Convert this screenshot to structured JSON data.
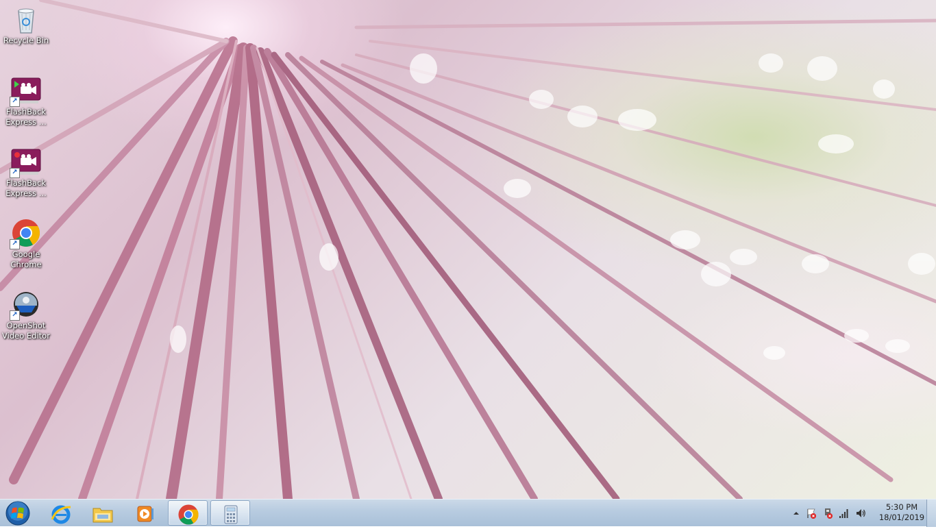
{
  "desktop": {
    "icons": [
      {
        "label_1": "Recycle Bin",
        "label_2": "",
        "icon": "recycle-bin-icon"
      },
      {
        "label_1": "FlashBack",
        "label_2": "Express ...",
        "icon": "flashback-player-icon"
      },
      {
        "label_1": "FlashBack",
        "label_2": "Express ...",
        "icon": "flashback-recorder-icon"
      },
      {
        "label_1": "Google",
        "label_2": "Chrome",
        "icon": "chrome-icon"
      },
      {
        "label_1": "OpenShot",
        "label_2": "Video Editor",
        "icon": "openshot-icon"
      }
    ]
  },
  "taskbar": {
    "pinned": [
      {
        "icon": "internet-explorer-icon"
      },
      {
        "icon": "windows-explorer-icon"
      },
      {
        "icon": "media-player-icon"
      },
      {
        "icon": "chrome-icon"
      },
      {
        "icon": "calculator-icon"
      }
    ],
    "tray": {
      "icons": [
        "show-hidden-icons-arrow",
        "action-center-flag-icon",
        "safely-remove-hardware-icon",
        "network-signal-icon",
        "volume-icon"
      ],
      "time": "5:30 PM",
      "date": "18/01/2019"
    }
  },
  "colors": {
    "taskbar": "#b7cbe0",
    "flashback": "#8a1c5c",
    "chrome_red": "#db4437",
    "chrome_green": "#0f9d58",
    "chrome_yellow": "#f4b400",
    "chrome_blue": "#4285f4"
  }
}
